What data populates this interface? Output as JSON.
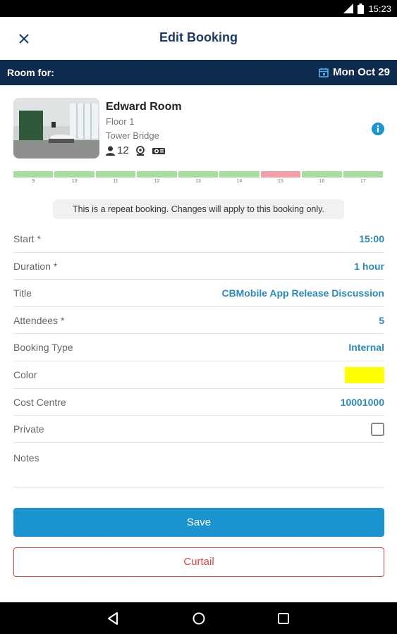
{
  "status_bar": {
    "time": "15:23"
  },
  "toolbar": {
    "title": "Edit Booking"
  },
  "room_for": {
    "label": "Room for:",
    "date": "Mon Oct 29"
  },
  "room": {
    "name": "Edward Room",
    "floor": "Floor 1",
    "building": "Tower Bridge",
    "capacity": "12",
    "icons": [
      "person-icon",
      "webcam-icon",
      "projector-icon",
      "info-icon"
    ]
  },
  "timeline": {
    "hours": [
      "9",
      "10",
      "11",
      "12",
      "13",
      "14",
      "15",
      "16",
      "17"
    ],
    "booked_hour": "15",
    "colors": {
      "available": "#a8dca0",
      "booked": "#f0a0a6"
    }
  },
  "notice": "This is a repeat booking. Changes will apply to this booking only.",
  "form": {
    "start": {
      "label": "Start *",
      "value": "15:00"
    },
    "duration": {
      "label": "Duration *",
      "value": "1 hour"
    },
    "title": {
      "label": "Title",
      "value": "CBMobile App Release Discussion"
    },
    "attendees": {
      "label": "Attendees *",
      "value": "5"
    },
    "booking_type": {
      "label": "Booking Type",
      "value": "Internal"
    },
    "color": {
      "label": "Color",
      "value": "#ffff00"
    },
    "cost_centre": {
      "label": "Cost Centre",
      "value": "10001000"
    },
    "private": {
      "label": "Private",
      "checked": false
    },
    "notes": {
      "label": "Notes",
      "value": ""
    }
  },
  "buttons": {
    "save": "Save",
    "curtail": "Curtail"
  },
  "colors": {
    "brand_navy": "#0e2a4e",
    "accent_blue": "#1b93cf",
    "danger": "#e0453c"
  }
}
